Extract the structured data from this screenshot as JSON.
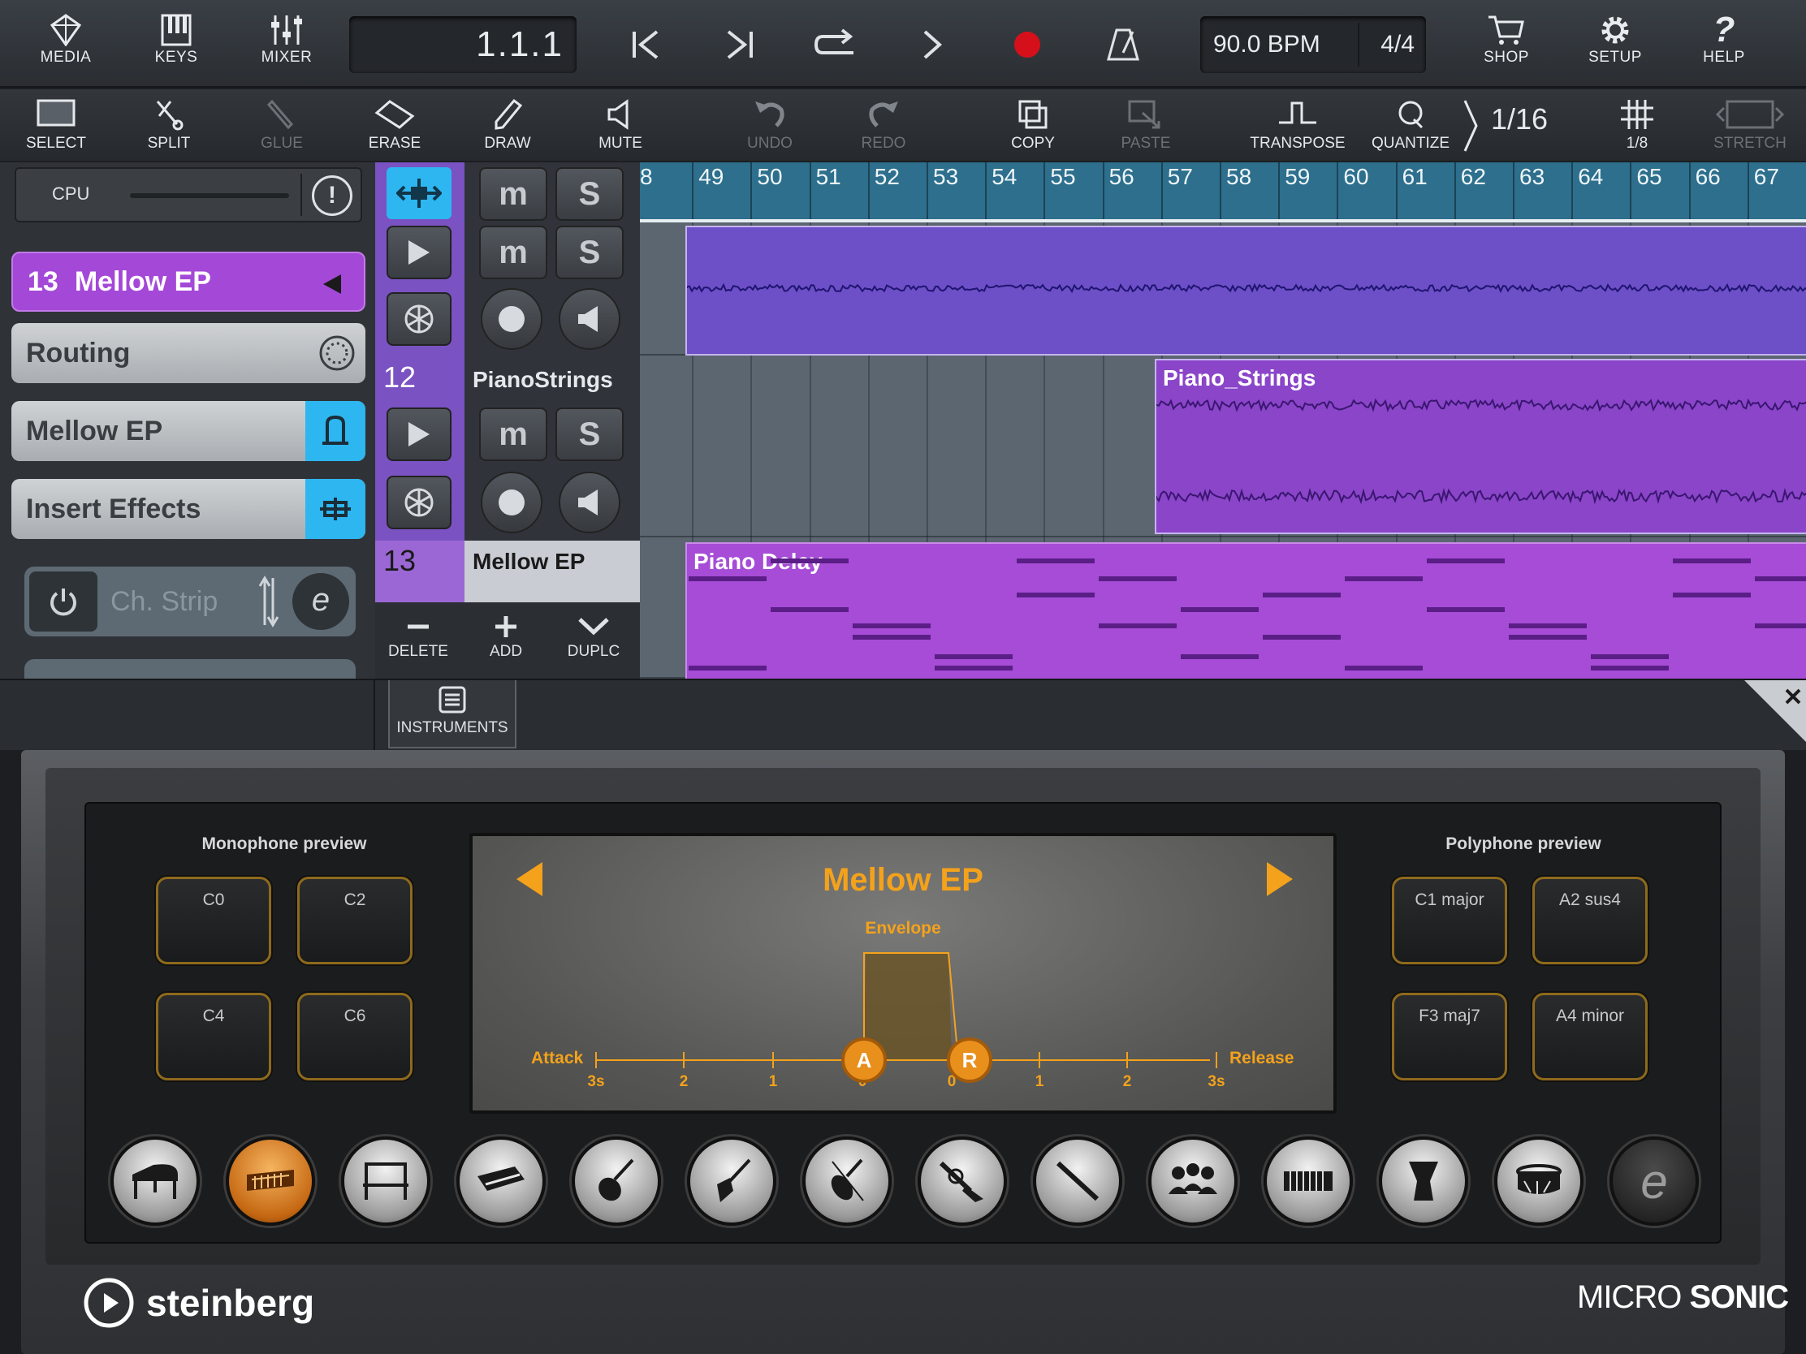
{
  "topbar": {
    "media": "MEDIA",
    "keys": "KEYS",
    "mixer": "MIXER",
    "position": "1.1.1",
    "tempo": "90.0 BPM",
    "signature": "4/4",
    "shop": "SHOP",
    "setup": "SETUP",
    "help": "HELP"
  },
  "toolbar": {
    "select": "SELECT",
    "split": "SPLIT",
    "glue": "GLUE",
    "erase": "ERASE",
    "draw": "DRAW",
    "mute": "MUTE",
    "undo": "UNDO",
    "redo": "REDO",
    "copy": "COPY",
    "paste": "PASTE",
    "transpose": "TRANSPOSE",
    "quantize": "QUANTIZE",
    "quantize_value": "1/16",
    "grid": "1/8",
    "stretch": "STRETCH"
  },
  "leftpanel": {
    "cpu": "CPU",
    "track_num": "13",
    "track_name": "Mellow EP",
    "routing": "Routing",
    "instrument": "Mellow EP",
    "insert_effects": "Insert Effects",
    "ch_strip": "Ch. Strip"
  },
  "tracks": {
    "t12_num": "12",
    "t12_name": "PianoStrings",
    "t13_num": "13",
    "t13_name": "Mellow EP",
    "delete": "DELETE",
    "add": "ADD",
    "duplicate": "DUPLC"
  },
  "ruler": [
    "8",
    "49",
    "50",
    "51",
    "52",
    "53",
    "54",
    "55",
    "56",
    "57",
    "58",
    "59",
    "60",
    "61",
    "62",
    "63",
    "64",
    "65",
    "66",
    "67"
  ],
  "events": {
    "piano_strings": "Piano_Strings",
    "piano_delay": "Piano Delay"
  },
  "instruments_tab": "INSTRUMENTS",
  "microsonic": {
    "mono_title": "Monophone preview",
    "mono_pads": [
      "C0",
      "C2",
      "C4",
      "C6"
    ],
    "poly_title": "Polyphone preview",
    "poly_pads": [
      "C1 major",
      "A2 sus4",
      "F3 maj7",
      "A4 minor"
    ],
    "preset": "Mellow EP",
    "envelope": "Envelope",
    "attack": "Attack",
    "release": "Release",
    "attack_ticks": [
      "3s",
      "2",
      "1",
      "0"
    ],
    "release_ticks": [
      "0",
      "1",
      "2",
      "3s"
    ],
    "attack_knob": "A",
    "release_knob": "R",
    "brand": "steinberg",
    "product_a": "MICRO",
    "product_b": "SONIC"
  },
  "colors": {
    "accent": "#2db6f0",
    "track_purple": "#a448d8",
    "orange": "#f4a21b"
  }
}
